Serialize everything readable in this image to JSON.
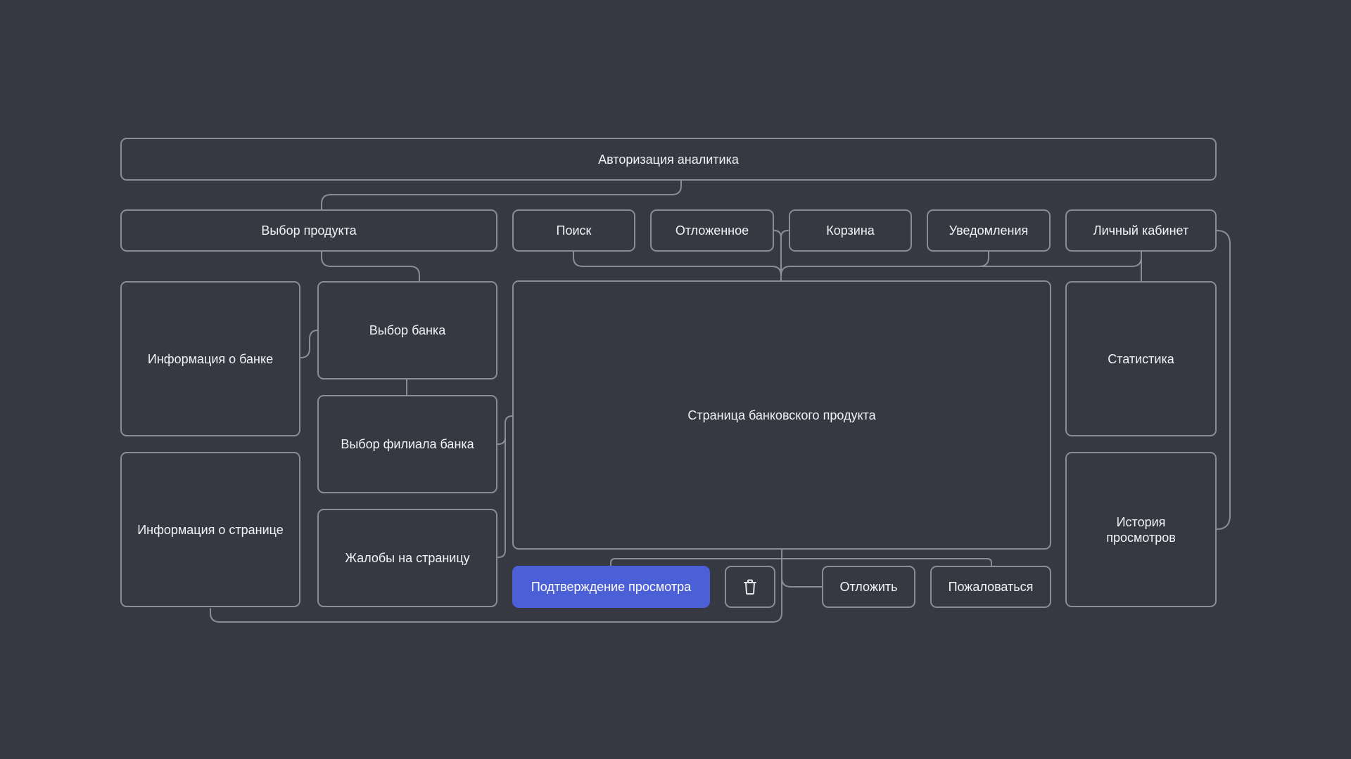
{
  "colors": {
    "background": "#363942",
    "border": "#8a8d95",
    "text": "#f2f3f5",
    "accent": "#4b5fd6"
  },
  "nodes": {
    "auth": "Авторизация аналитика",
    "product_select": "Выбор продукта",
    "search": "Поиск",
    "saved": "Отложенное",
    "cart": "Корзина",
    "notifications": "Уведомления",
    "account": "Личный кабинет",
    "bank_info": "Информация о банке",
    "bank_select": "Выбор банка",
    "branch_select": "Выбор филиала банка",
    "page_complaints": "Жалобы на страницу",
    "page_info": "Информация о странице",
    "product_page": "Страница банковского продукта",
    "statistics": "Статистика",
    "history": "История просмотров",
    "confirm_view": "Подтверждение просмотра",
    "postpone": "Отложить",
    "complain": "Пожаловаться"
  },
  "icons": {
    "delete_button": "trash-icon"
  }
}
